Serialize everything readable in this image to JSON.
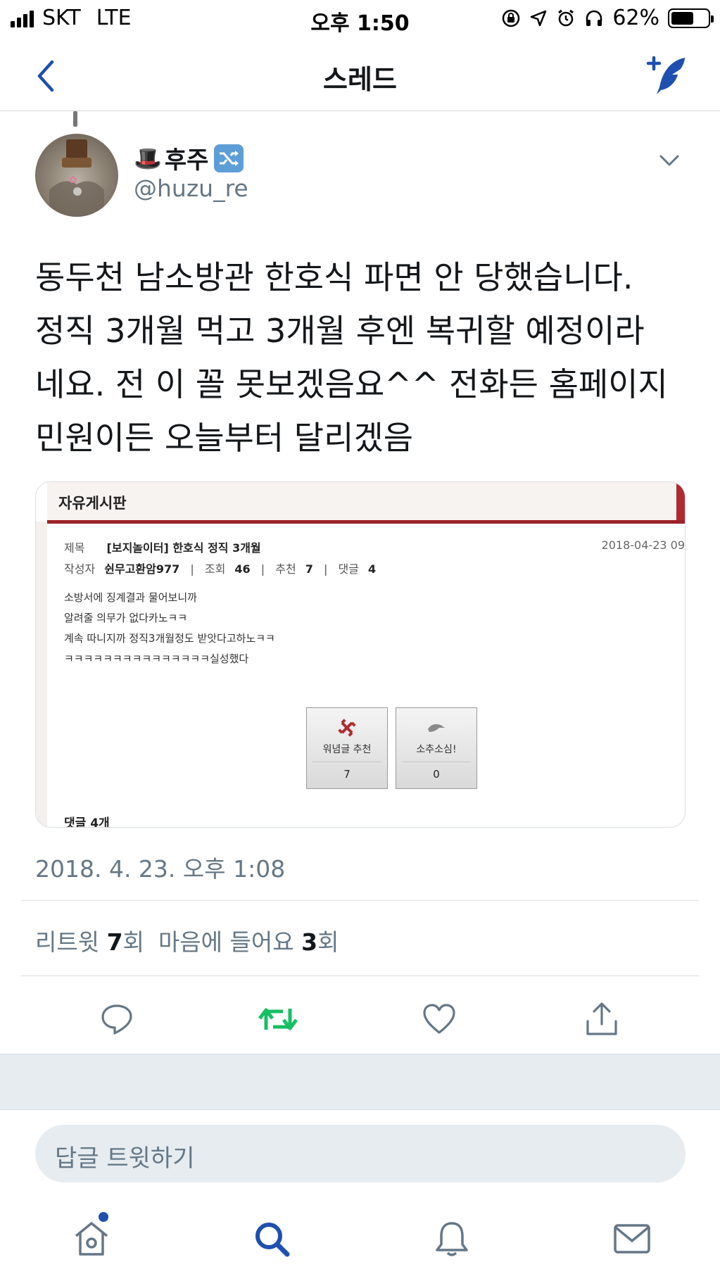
{
  "status_bar": {
    "carrier": "SKT",
    "network": "LTE",
    "time": "오후 1:50",
    "battery_percent": "62%",
    "battery_level": 0.62
  },
  "nav": {
    "back_icon": "chevron-left-icon",
    "title": "스레드",
    "compose_icon": "feather-plus-icon",
    "accent_color": "#1f4fb0"
  },
  "tweet": {
    "display_name": "후주",
    "display_name_prefix_emoji": "🎩",
    "display_name_suffix_icon": "shuffle-icon",
    "handle": "@huzu_re",
    "text": "동두천 남소방관 한호식 파면 안 당했습니다.\n정직 3개월 먹고 3개월 후엔 복귀할 예정이라\n네요. 전 이 꼴 못보겠음요^^ 전화든 홈페이지\n민원이든 오늘부터 달리겠음",
    "timestamp": "2018. 4. 23. 오후 1:08",
    "retweets_label": "리트윗",
    "retweets_count": "7",
    "retweets_suffix": "회",
    "likes_label": "마음에 들어요",
    "likes_count": "3",
    "likes_suffix": "회"
  },
  "embedded_image": {
    "board_title": "자유게시판",
    "subject_label": "제목",
    "subject": "[보지놀이터] 한호식 정직 3개월",
    "date": "2018-04-23 09",
    "author_label": "작성자",
    "author": "쉰무고환암977",
    "views_label": "조회",
    "views": "46",
    "recommend_label": "추천",
    "recommend": "7",
    "comments_label": "댓글",
    "comments": "4",
    "body_lines": [
      "소방서에 징계결과 물어보니까",
      "알려줄 의무가 없다카노ㅋㅋ",
      "계속 따니지까 정직3개월정도 받앗다고하노ㅋㅋ",
      "ㅋㅋㅋㅋㅋㅋㅋㅋㅋㅋㅋㅋㅋㅋㅋ실성했다"
    ],
    "vote_up_label": "워념글 추천",
    "vote_up_count": "7",
    "vote_down_label": "소추소심!",
    "vote_down_count": "0",
    "comment_total": "댓글 4개",
    "accent_color": "#9b2226"
  },
  "actions": {
    "reply_icon": "reply-bubble-icon",
    "retweet_icon": "retweet-icon",
    "retweet_color": "#17bf63",
    "like_icon": "heart-icon",
    "share_icon": "share-icon"
  },
  "reply_bar": {
    "placeholder": "답글 트윗하기"
  },
  "tabbar": {
    "items": [
      "home-icon",
      "search-icon",
      "bell-icon",
      "mail-icon"
    ],
    "active": "search-icon"
  }
}
